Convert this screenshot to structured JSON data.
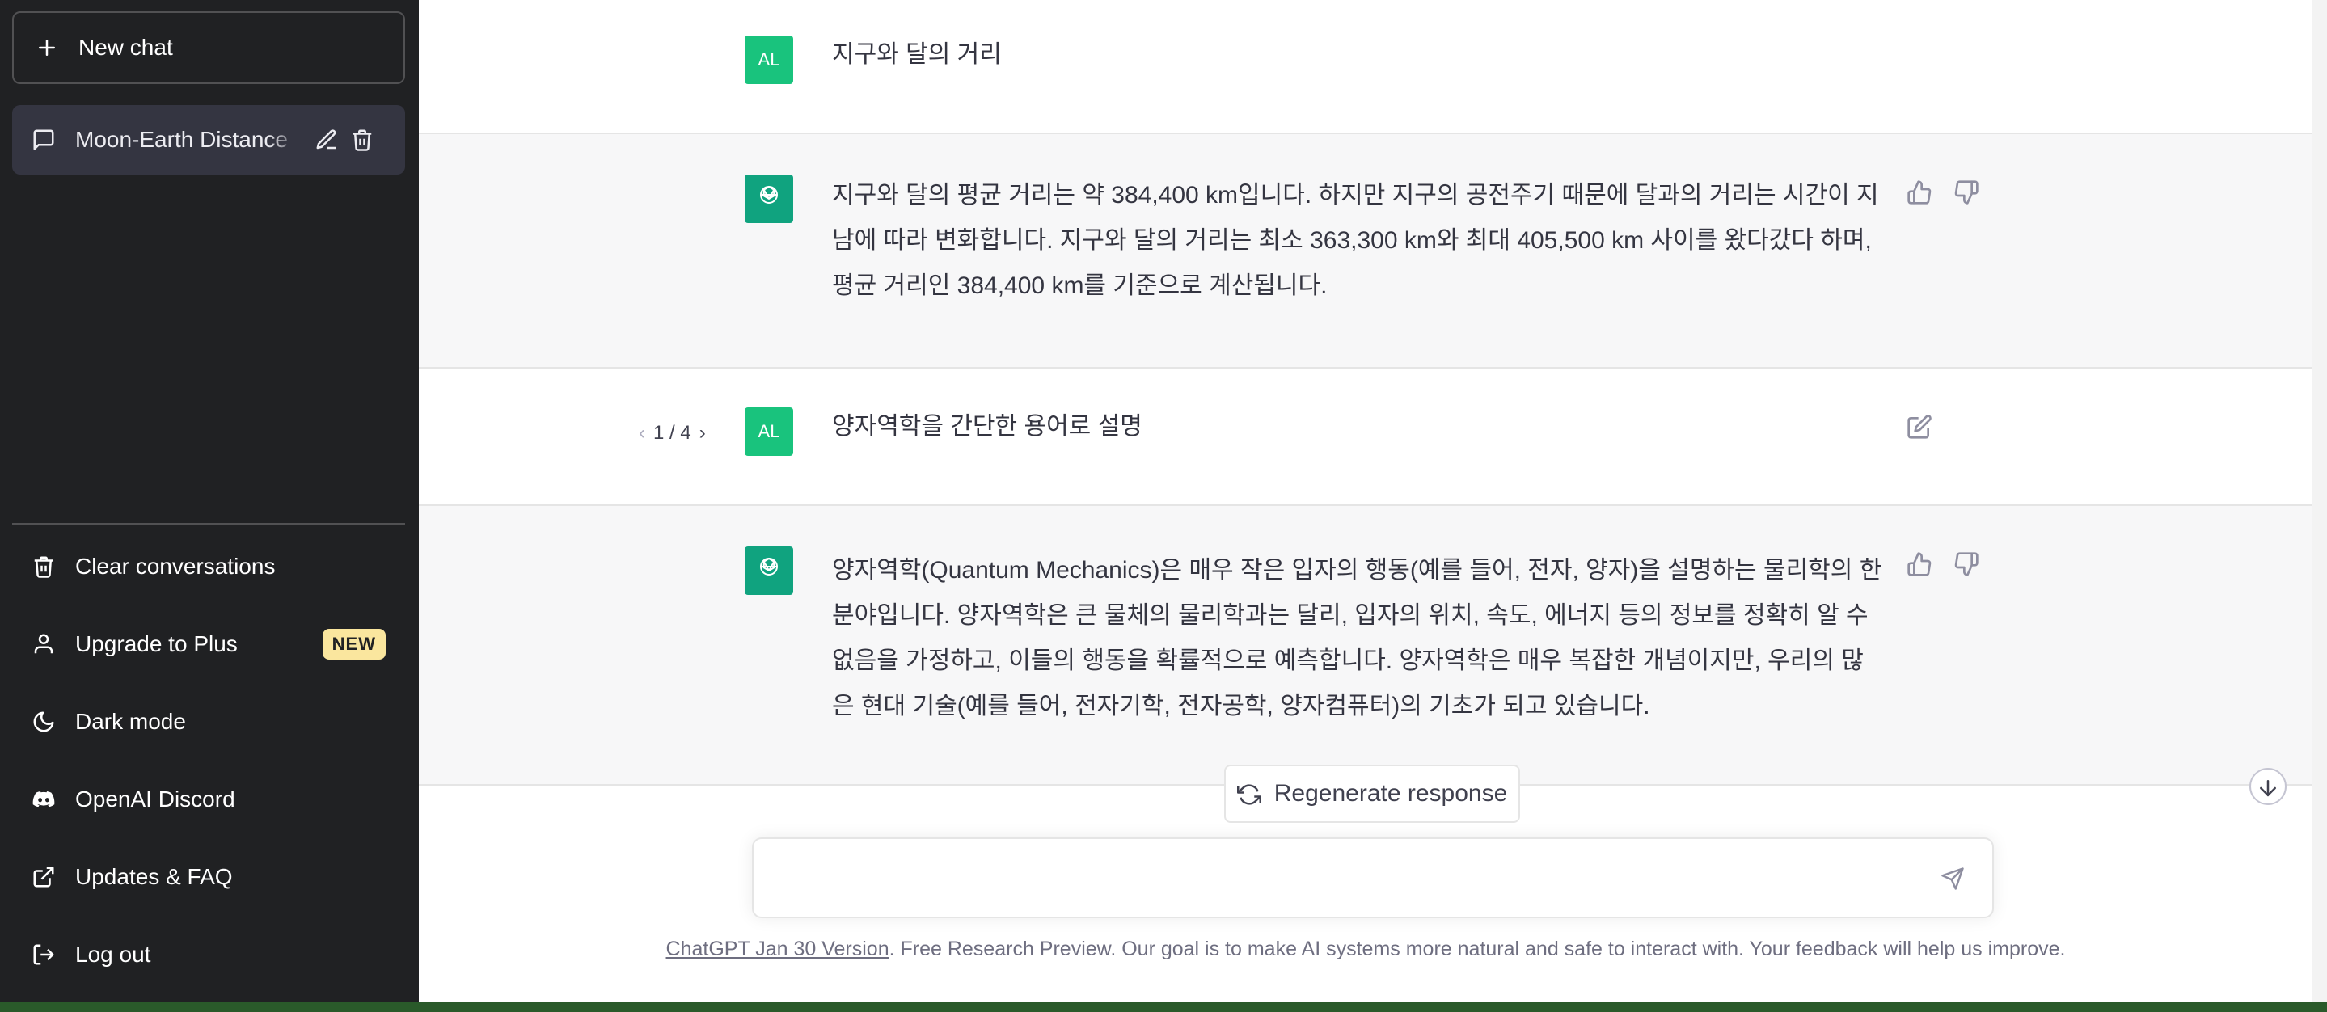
{
  "sidebar": {
    "new_chat_label": "New chat",
    "history": [
      {
        "label": "Moon-Earth Distance"
      }
    ],
    "menu": [
      {
        "label": "Clear conversations"
      },
      {
        "label": "Upgrade to Plus",
        "badge": "NEW"
      },
      {
        "label": "Dark mode"
      },
      {
        "label": "OpenAI Discord"
      },
      {
        "label": "Updates & FAQ"
      },
      {
        "label": "Log out"
      }
    ]
  },
  "conversation": {
    "user_avatar_initials": "AL",
    "messages": [
      {
        "role": "user",
        "text": "지구와 달의 거리"
      },
      {
        "role": "assistant",
        "text": "지구와 달의 평균 거리는 약 384,400 km입니다. 하지만 지구의 공전주기 때문에 달과의 거리는 시간이 지남에 따라 변화합니다. 지구와 달의 거리는 최소 363,300 km와 최대 405,500 km 사이를 왔다갔다 하며, 평균 거리인 384,400 km를 기준으로 계산됩니다."
      },
      {
        "role": "user",
        "text": "양자역학을 간단한 용어로 설명",
        "pager": "1 / 4"
      },
      {
        "role": "assistant",
        "text": "양자역학(Quantum Mechanics)은 매우 작은 입자의 행동(예를 들어, 전자, 양자)을 설명하는 물리학의 한 분야입니다. 양자역학은 큰 물체의 물리학과는 달리, 입자의 위치, 속도, 에너지 등의 정보를 정확히 알 수 없음을 가정하고, 이들의 행동을 확률적으로 예측합니다. 양자역학은 매우 복잡한 개념이지만, 우리의 많은 현대 기술(예를 들어, 전자기학, 전자공학, 양자컴퓨터)의 기초가 되고 있습니다."
      }
    ]
  },
  "regenerate_label": "Regenerate response",
  "input": {
    "value": "",
    "placeholder": ""
  },
  "footer": {
    "link_text": "ChatGPT Jan 30 Version",
    "rest_text": ". Free Research Preview. Our goal is to make AI systems more natural and safe to interact with. Your feedback will help us improve."
  },
  "colors": {
    "sidebar_bg": "#202123",
    "user_avatar": "#19c37d",
    "assistant_avatar": "#10a37f",
    "badge": "#fae69e"
  }
}
